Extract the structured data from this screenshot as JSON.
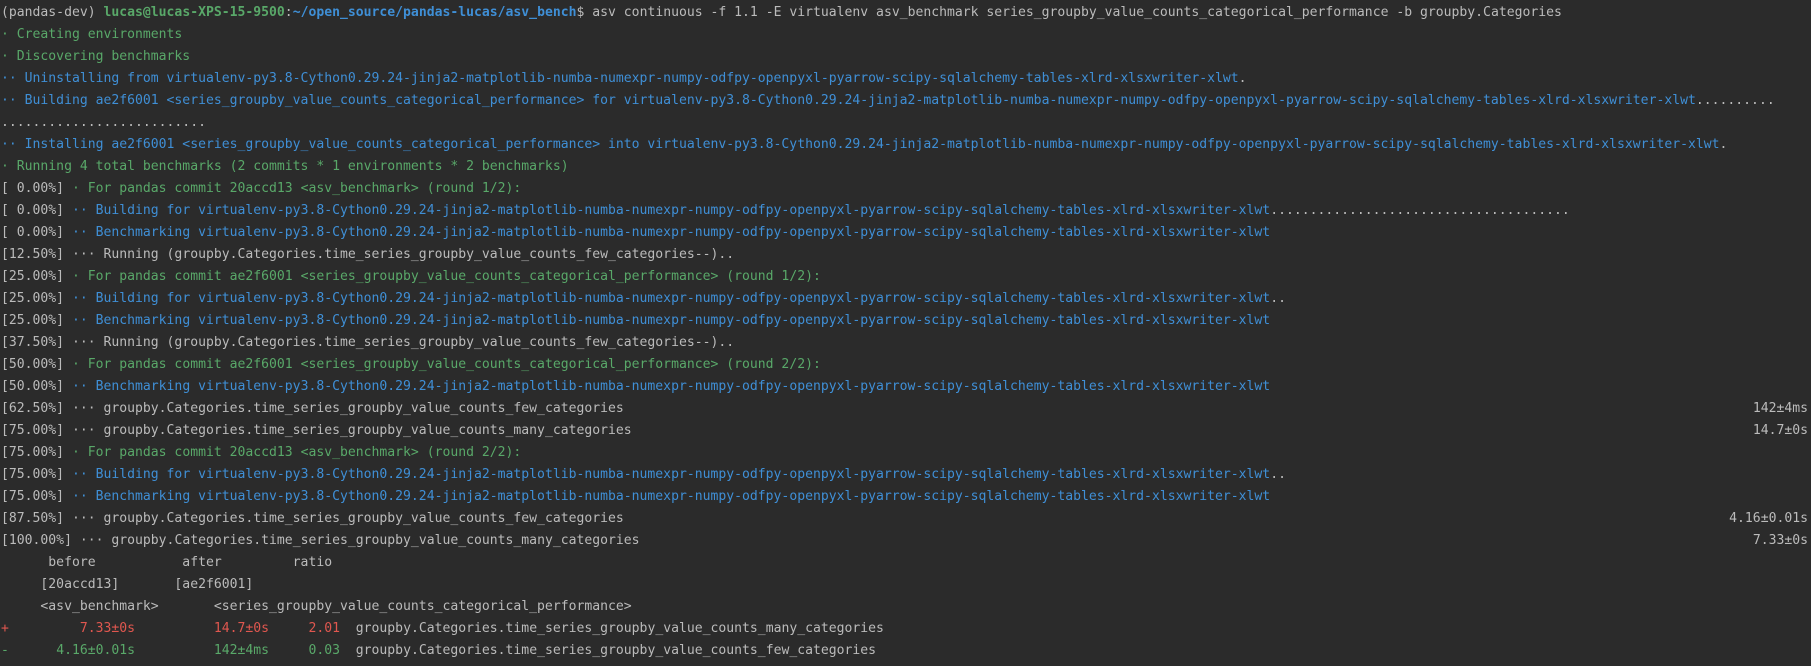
{
  "prompt": {
    "env": "(pandas-dev) ",
    "user": "lucas@lucas-XPS-15-9500",
    "colon": ":",
    "path": "~/open_source/pandas-lucas/asv_bench",
    "dollar": "$ ",
    "command": "asv continuous -f 1.1 -E virtualenv asv_benchmark series_groupby_value_counts_categorical_performance -b groupby.Categories"
  },
  "setup": {
    "creating": "· Creating environments",
    "discovering": "· Discovering benchmarks",
    "uninstalling": "·· Uninstalling from virtualenv-py3.8-Cython0.29.24-jinja2-matplotlib-numba-numexpr-numpy-odfpy-openpyxl-pyarrow-scipy-sqlalchemy-tables-xlrd-xlsxwriter-xlwt",
    "uninstalling_dots": ".",
    "building": "·· Building ae2f6001 <series_groupby_value_counts_categorical_performance> for virtualenv-py3.8-Cython0.29.24-jinja2-matplotlib-numba-numexpr-numpy-odfpy-openpyxl-pyarrow-scipy-sqlalchemy-tables-xlrd-xlsxwriter-xlwt",
    "building_dots": "..........",
    "building_dots_cont": "..........................",
    "installing": "·· Installing ae2f6001 <series_groupby_value_counts_categorical_performance> into virtualenv-py3.8-Cython0.29.24-jinja2-matplotlib-numba-numexpr-numpy-odfpy-openpyxl-pyarrow-scipy-sqlalchemy-tables-xlrd-xlsxwriter-xlwt",
    "installing_dots": ".",
    "running_total": "· Running 4 total benchmarks (2 commits * 1 environments * 2 benchmarks)"
  },
  "progress": [
    {
      "pct": "[ 0.00%] ",
      "text": "· For pandas commit 20accd13 <asv_benchmark> (round 1/2):",
      "style": "green",
      "tail": "",
      "timing": ""
    },
    {
      "pct": "[ 0.00%] ",
      "text": "·· Building for virtualenv-py3.8-Cython0.29.24-jinja2-matplotlib-numba-numexpr-numpy-odfpy-openpyxl-pyarrow-scipy-sqlalchemy-tables-xlrd-xlsxwriter-xlwt",
      "style": "blue",
      "tail": "......................................",
      "timing": ""
    },
    {
      "pct": "[ 0.00%] ",
      "text": "·· Benchmarking virtualenv-py3.8-Cython0.29.24-jinja2-matplotlib-numba-numexpr-numpy-odfpy-openpyxl-pyarrow-scipy-sqlalchemy-tables-xlrd-xlsxwriter-xlwt",
      "style": "blue",
      "tail": "",
      "timing": ""
    },
    {
      "pct": "[12.50%] ",
      "text": "··· Running (groupby.Categories.time_series_groupby_value_counts_few_categories--)..",
      "style": "white",
      "tail": "",
      "timing": ""
    },
    {
      "pct": "[25.00%] ",
      "text": "· For pandas commit ae2f6001 <series_groupby_value_counts_categorical_performance> (round 1/2):",
      "style": "green",
      "tail": "",
      "timing": ""
    },
    {
      "pct": "[25.00%] ",
      "text": "·· Building for virtualenv-py3.8-Cython0.29.24-jinja2-matplotlib-numba-numexpr-numpy-odfpy-openpyxl-pyarrow-scipy-sqlalchemy-tables-xlrd-xlsxwriter-xlwt",
      "style": "blue",
      "tail": "..",
      "timing": ""
    },
    {
      "pct": "[25.00%] ",
      "text": "·· Benchmarking virtualenv-py3.8-Cython0.29.24-jinja2-matplotlib-numba-numexpr-numpy-odfpy-openpyxl-pyarrow-scipy-sqlalchemy-tables-xlrd-xlsxwriter-xlwt",
      "style": "blue",
      "tail": "",
      "timing": ""
    },
    {
      "pct": "[37.50%] ",
      "text": "··· Running (groupby.Categories.time_series_groupby_value_counts_few_categories--)..",
      "style": "white",
      "tail": "",
      "timing": ""
    },
    {
      "pct": "[50.00%] ",
      "text": "· For pandas commit ae2f6001 <series_groupby_value_counts_categorical_performance> (round 2/2):",
      "style": "green",
      "tail": "",
      "timing": ""
    },
    {
      "pct": "[50.00%] ",
      "text": "·· Benchmarking virtualenv-py3.8-Cython0.29.24-jinja2-matplotlib-numba-numexpr-numpy-odfpy-openpyxl-pyarrow-scipy-sqlalchemy-tables-xlrd-xlsxwriter-xlwt",
      "style": "blue",
      "tail": "",
      "timing": ""
    },
    {
      "pct": "[62.50%] ",
      "text": "··· groupby.Categories.time_series_groupby_value_counts_few_categories",
      "style": "white",
      "tail": "",
      "timing": "142±4ms"
    },
    {
      "pct": "[75.00%] ",
      "text": "··· groupby.Categories.time_series_groupby_value_counts_many_categories",
      "style": "white",
      "tail": "",
      "timing": "14.7±0s"
    },
    {
      "pct": "[75.00%] ",
      "text": "· For pandas commit 20accd13 <asv_benchmark> (round 2/2):",
      "style": "green",
      "tail": "",
      "timing": ""
    },
    {
      "pct": "[75.00%] ",
      "text": "·· Building for virtualenv-py3.8-Cython0.29.24-jinja2-matplotlib-numba-numexpr-numpy-odfpy-openpyxl-pyarrow-scipy-sqlalchemy-tables-xlrd-xlsxwriter-xlwt",
      "style": "blue",
      "tail": "..",
      "timing": ""
    },
    {
      "pct": "[75.00%] ",
      "text": "·· Benchmarking virtualenv-py3.8-Cython0.29.24-jinja2-matplotlib-numba-numexpr-numpy-odfpy-openpyxl-pyarrow-scipy-sqlalchemy-tables-xlrd-xlsxwriter-xlwt",
      "style": "blue",
      "tail": "",
      "timing": ""
    },
    {
      "pct": "[87.50%] ",
      "text": "··· groupby.Categories.time_series_groupby_value_counts_few_categories",
      "style": "white",
      "tail": "",
      "timing": "4.16±0.01s"
    },
    {
      "pct": "[100.00%] ",
      "text": "··· groupby.Categories.time_series_groupby_value_counts_many_categories",
      "style": "white",
      "tail": "",
      "timing": "7.33±0s"
    }
  ],
  "summary": {
    "header": "      before           after         ratio",
    "commits": "     [20accd13]       [ae2f6001]",
    "branches": "     <asv_benchmark>       <series_groupby_value_counts_categorical_performance>",
    "rows": [
      {
        "sign": "+",
        "before": "         7.33±0s",
        "after": "          14.7±0s",
        "ratio": "     2.01",
        "name": "  groupby.Categories.time_series_groupby_value_counts_many_categories",
        "color": "red"
      },
      {
        "sign": "-",
        "before": "      4.16±0.01s",
        "after": "          142±4ms",
        "ratio": "     0.03",
        "name": "  groupby.Categories.time_series_groupby_value_counts_few_categories",
        "color": "green"
      }
    ]
  }
}
